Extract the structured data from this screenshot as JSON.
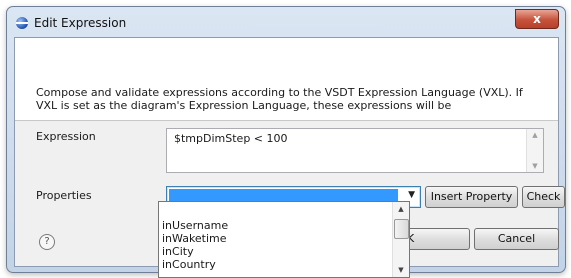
{
  "window": {
    "title": "Edit Expression",
    "close_label": "x"
  },
  "description": "Compose and validate expressions according to the VSDT Expression Language (VXL).  If VXL is set as the diagram's Expression Language, these expressions will be",
  "expression": {
    "label": "Expression",
    "value": "$tmpDimStep < 100"
  },
  "properties": {
    "label": "Properties",
    "selected": ""
  },
  "buttons": {
    "insert_property": "Insert Property",
    "check": "Check",
    "ok": "K",
    "cancel": "Cancel"
  },
  "help": {
    "glyph": "?"
  },
  "dropdown": {
    "items": [
      "inUsername",
      "inWaketime",
      "inCity",
      "inCountry"
    ]
  },
  "colors": {
    "selection": "#3399ff",
    "close_button": "#c6533b"
  }
}
